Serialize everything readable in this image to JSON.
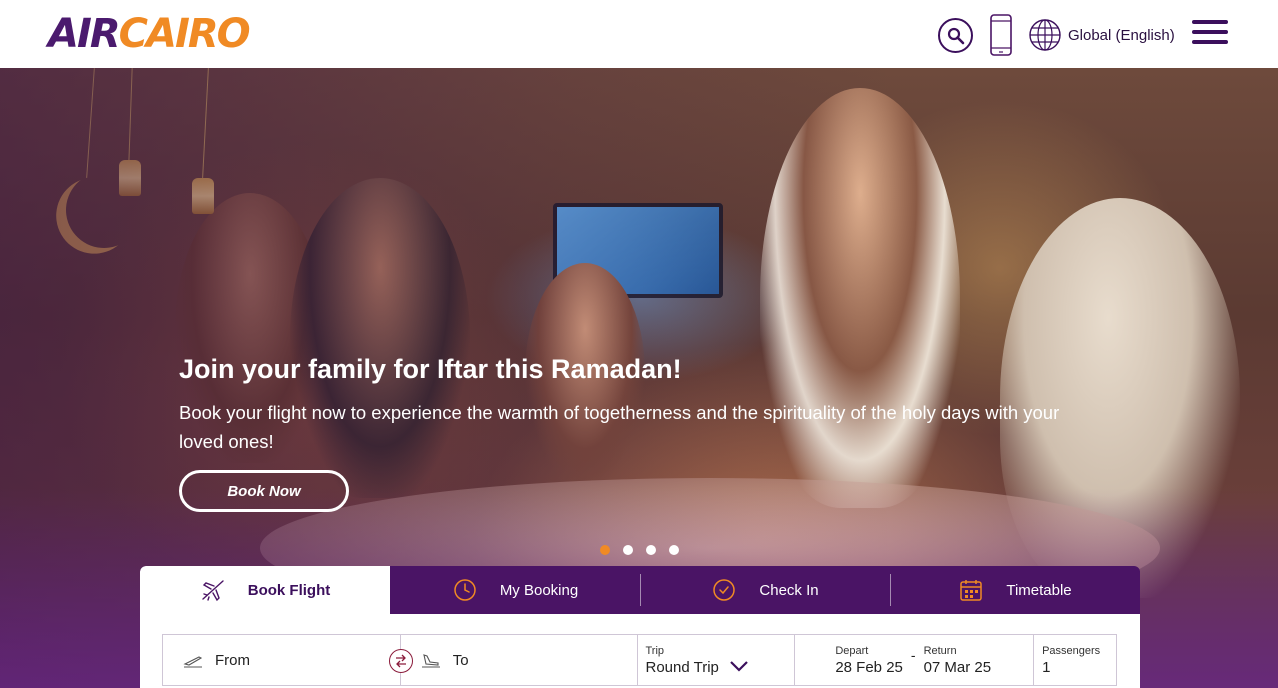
{
  "header": {
    "logo": {
      "part1": "AIR",
      "part2": "CAIRO"
    },
    "search_icon": "search-icon",
    "mobile_icon": "mobile-phone-icon",
    "language": {
      "icon": "globe-icon",
      "label": "Global (English)"
    },
    "menu_icon": "hamburger-menu-icon"
  },
  "hero": {
    "title": "Join your family for Iftar this Ramadan!",
    "subtitle": "Book your flight now to experience the warmth of togetherness and the spirituality of the holy days with your loved ones!",
    "cta_label": "Book Now",
    "slides": {
      "count": 4,
      "active_index": 0
    }
  },
  "booking": {
    "tabs": [
      {
        "label": "Book Flight",
        "icon": "plane-icon",
        "active": true
      },
      {
        "label": "My Booking",
        "icon": "clock-icon",
        "active": false
      },
      {
        "label": "Check In",
        "icon": "clock-check-icon",
        "active": false
      },
      {
        "label": "Timetable",
        "icon": "calendar-icon",
        "active": false
      }
    ],
    "from_placeholder": "From",
    "to_placeholder": "To",
    "trip": {
      "label": "Trip",
      "value": "Round Trip"
    },
    "depart": {
      "label": "Depart",
      "value": "28 Feb 25"
    },
    "return": {
      "label": "Return",
      "value": "07 Mar 25"
    },
    "date_separator": "-",
    "passengers": {
      "label": "Passengers",
      "value": "1"
    }
  },
  "colors": {
    "brand_purple": "#4a1465",
    "brand_orange": "#f08a24",
    "dot_active": "#f08a24"
  }
}
